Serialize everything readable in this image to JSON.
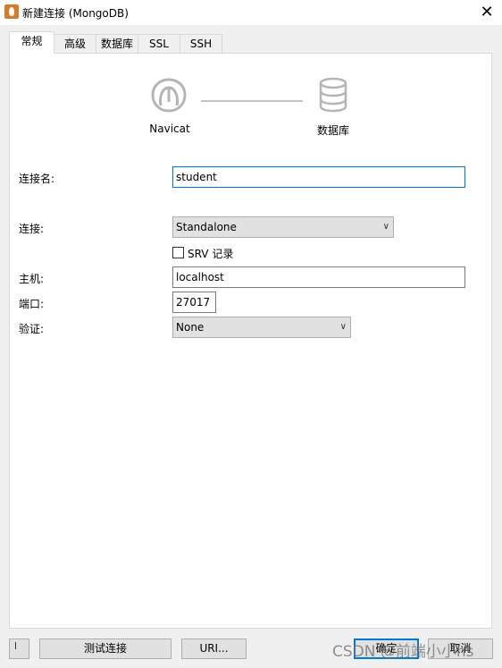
{
  "window": {
    "title": "新建连接 (MongoDB)",
    "close_glyph": "✕"
  },
  "tabs": [
    {
      "label": "常规",
      "active": true
    },
    {
      "label": "高级"
    },
    {
      "label": "数据库"
    },
    {
      "label": "SSL"
    },
    {
      "label": "SSH"
    }
  ],
  "diagram": {
    "left_label": "Navicat",
    "right_label": "数据库",
    "left_icon": "navicat-logo-icon",
    "right_icon": "database-icon"
  },
  "form": {
    "connection_name": {
      "label": "连接名:",
      "value": "student"
    },
    "connection_type": {
      "label": "连接:",
      "value": "Standalone"
    },
    "srv": {
      "label": "SRV 记录",
      "checked": false
    },
    "host": {
      "label": "主机:",
      "value": "localhost"
    },
    "port": {
      "label": "端口:",
      "value": "27017"
    },
    "auth": {
      "label": "验证:",
      "value": "None"
    }
  },
  "buttons": {
    "test": "测试连接",
    "uri": "URI...",
    "ok": "确定",
    "cancel": "取消"
  },
  "watermark": "CSDN @前端小小hs",
  "colors": {
    "accent": "#0078d7",
    "app_icon": "#d97a2b"
  }
}
